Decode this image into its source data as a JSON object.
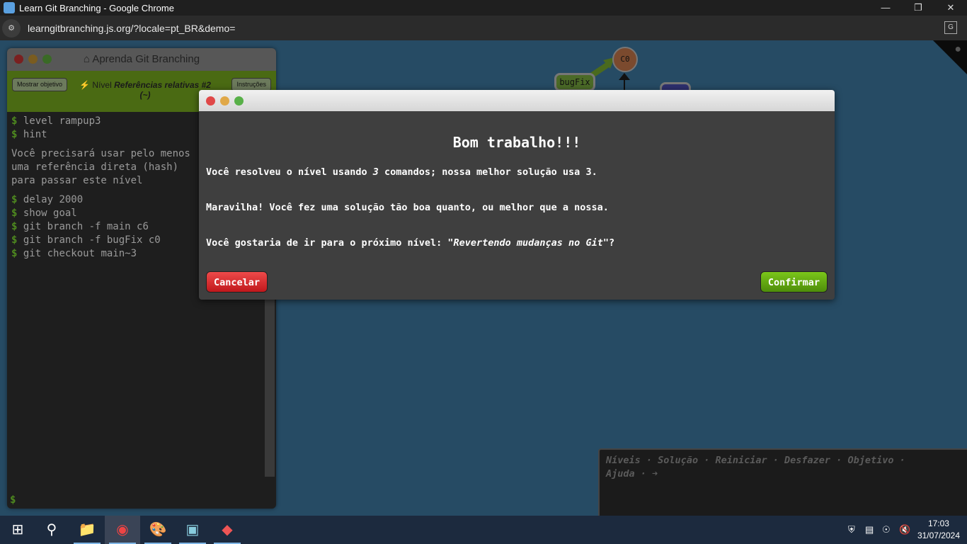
{
  "browser": {
    "title": "Learn Git Branching - Google Chrome",
    "url": "learngitbranching.js.org/?locale=pt_BR&demo="
  },
  "graph": {
    "nodes": [
      {
        "label": "C0"
      }
    ],
    "branches": [
      {
        "label": "bugFix"
      }
    ]
  },
  "terminal": {
    "title": "Aprenda Git Branching",
    "show_goal": "Mostrar objetivo",
    "instructions": "Instruções",
    "level_prefix": "Nível",
    "level_name": "Referências relativas #2",
    "level_sub": "(~)",
    "lines_a": [
      "level rampup3",
      "hint"
    ],
    "hint_text": "Você precisará usar pelo menos uma referência direta (hash) para passar este nível",
    "lines_b": [
      "delay 2000",
      "show goal",
      "git branch -f main c6",
      "git branch -f bugFix c0",
      "git checkout main~3"
    ],
    "prompt": "$"
  },
  "modal": {
    "title": "Bom trabalho!!!",
    "line1_a": "Você resolveu o nível usando ",
    "line1_n": "3",
    "line1_b": " comandos; nossa melhor solução usa 3.",
    "line2": "Maravilha! Você fez uma solução tão boa quanto, ou melhor que a nossa.",
    "line3_a": "Você gostaria de ir para o próximo nível: ",
    "line3_level": "\"Revertendo mudanças no Git\"",
    "line3_b": "?",
    "cancel": "Cancelar",
    "confirm": "Confirmar"
  },
  "commands": [
    "Níveis",
    "Solução",
    "Reiniciar",
    "Desfazer",
    "Objetivo",
    "Ajuda"
  ],
  "taskbar": {
    "time": "17:03",
    "date": "31/07/2024"
  },
  "colors": {
    "cancel": "#d9262a",
    "confirm": "#5da20e",
    "stage": "#264b64"
  }
}
